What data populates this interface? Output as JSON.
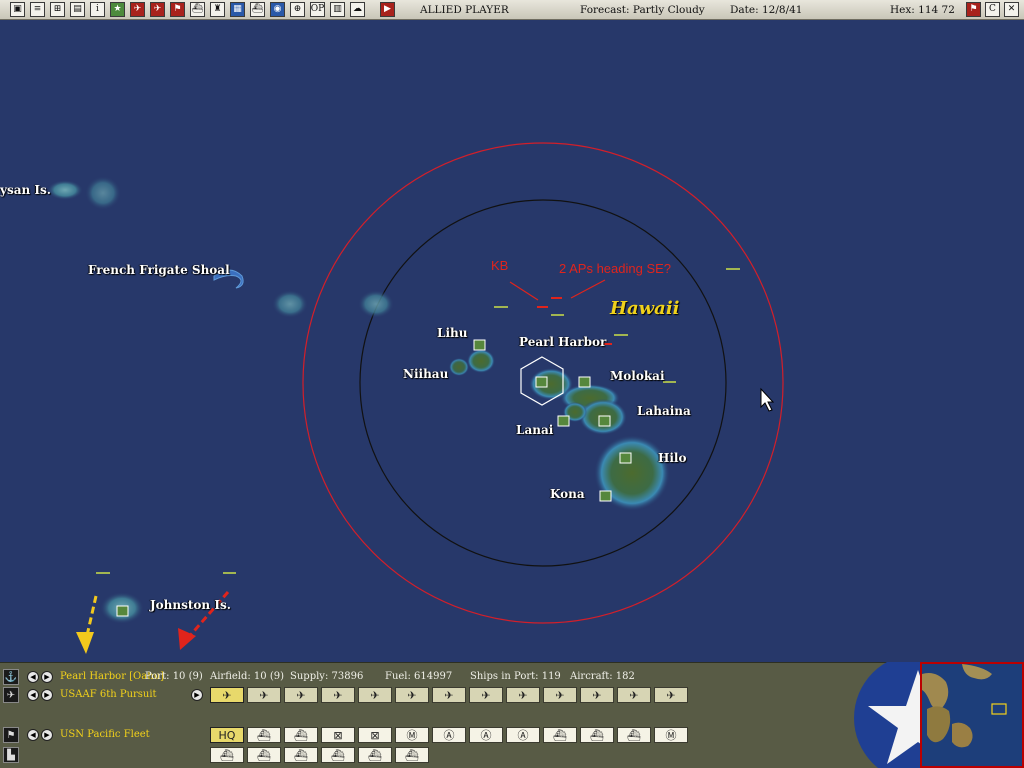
{
  "topbar": {
    "side": "ALLIED PLAYER",
    "forecast": "Forecast: Partly Cloudy",
    "date": "Date: 12/8/41",
    "hex": "Hex: 114  72",
    "right_c": "C",
    "buttons": [
      {
        "icon": "window-icon",
        "glyph": "▣"
      },
      {
        "icon": "document-icon",
        "glyph": "≡"
      },
      {
        "icon": "task-force-icon",
        "glyph": "⊞"
      },
      {
        "icon": "save-icon",
        "glyph": "▤"
      },
      {
        "icon": "info-icon",
        "glyph": "i"
      },
      {
        "icon": "airbase-star-icon",
        "glyph": "★"
      },
      {
        "icon": "air-group-icon",
        "glyph": "✈"
      },
      {
        "icon": "air-mission-icon",
        "glyph": "✈"
      },
      {
        "icon": "flag-icon",
        "glyph": "⚑"
      },
      {
        "icon": "ship-icon",
        "glyph": "⛴"
      },
      {
        "icon": "leader-icon",
        "glyph": "♜"
      },
      {
        "icon": "unit-icon",
        "glyph": "▦"
      },
      {
        "icon": "convoy-icon",
        "glyph": "⛴"
      },
      {
        "icon": "globe-icon",
        "glyph": "◉"
      },
      {
        "icon": "production-icon",
        "glyph": "⊕"
      },
      {
        "icon": "op-icon",
        "glyph": "OP"
      },
      {
        "icon": "report-icon",
        "glyph": "▥"
      },
      {
        "icon": "weather-icon",
        "glyph": "☁"
      },
      {
        "icon": "end-turn-icon",
        "glyph": "▶"
      }
    ]
  },
  "map": {
    "labels": {
      "laysan": "ysan Is.",
      "french_frigate": "French Frigate Shoal",
      "lihu": "Lihu",
      "niihau": "Niihau",
      "pearl_harbor": "Pearl Harbor",
      "molokai": "Molokai",
      "lahaina": "Lahaina",
      "lanai": "Lanai",
      "hilo": "Hilo",
      "kona": "Kona",
      "johnston": "Johnston Is."
    },
    "region": "Hawaii",
    "annotations": {
      "kb": "KB",
      "aps": "2 APs heading SE?"
    },
    "colors": {
      "ocean": "#27386a",
      "outer_ring": "#d21f2a",
      "inner_ring": "#111111",
      "annotation": "#e0241c",
      "region_label": "#f1d21b"
    }
  },
  "bottom": {
    "base": {
      "name": "Pearl Harbor [Oahu]",
      "port": "Port: 10 (9)",
      "airfield": "Airfield: 10 (9)",
      "supply": "Supply: 73896",
      "fuel": "Fuel: 614997",
      "ships": "Ships in Port: 119",
      "aircraft": "Aircraft: 182"
    },
    "air_unit": "USAAF 6th Pursuit",
    "fleet": "USN Pacific Fleet",
    "hq_label": "HQ",
    "aircraft_slots": 13,
    "unit_slots": [
      "HQ",
      "ship",
      "ship",
      "box",
      "box",
      "M",
      "A",
      "A",
      "A",
      "ship",
      "ship",
      "ship",
      "M"
    ],
    "ship_slots": 6
  }
}
